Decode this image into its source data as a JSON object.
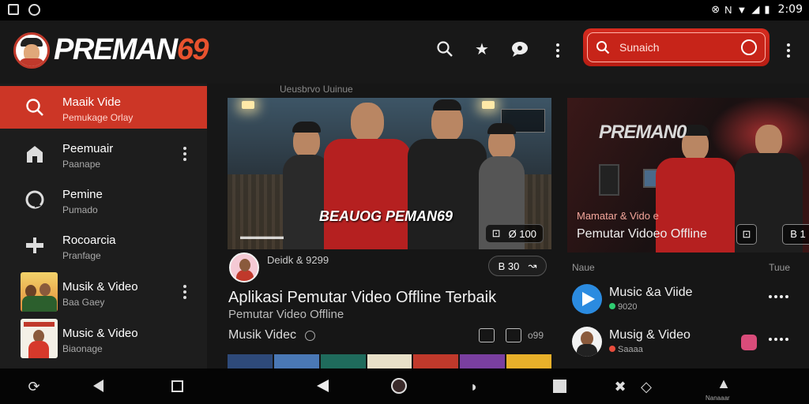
{
  "status": {
    "time": "2:09"
  },
  "header": {
    "brand_main": "PREMAN",
    "brand_num": "69",
    "search_placeholder": "Sunaich"
  },
  "icons": {
    "search": "search-icon",
    "star": "star-icon",
    "chat": "chat-icon",
    "more": "more-vert-icon",
    "mic": "mic-icon"
  },
  "sidebar": {
    "items": [
      {
        "title": "Maaik Vide",
        "sub": "Pemukage Orlay",
        "icon": "search-icon",
        "active": true
      },
      {
        "title": "Peemuair",
        "sub": "Paanape",
        "icon": "home-icon"
      },
      {
        "title": "Pemine",
        "sub": "Pumado",
        "icon": "explore-icon"
      },
      {
        "title": "Rocoarcia",
        "sub": "Pranfage",
        "icon": "library-icon"
      },
      {
        "title": "Musik & Video",
        "sub": "Baa Gaey",
        "icon": "thumbnail"
      },
      {
        "title": "Music & Video",
        "sub": "Biaonage",
        "icon": "thumbnail"
      }
    ]
  },
  "main": {
    "top_faint": "Ueusbrvo Uuinue",
    "featured": {
      "overlay_title": "BEAUOG PEMAN69",
      "badge": "Ø 100",
      "channel": "Deidk & 9299",
      "pill": "B 30",
      "title": "Aplikasi Pemutar Video Offline Terbaik",
      "subtitle": "Pemutar Video Offline",
      "category": "Musik Videc",
      "action_text": "o99"
    },
    "side_card": {
      "title": "PREMAN0",
      "line1": "Mamatar & Vido e",
      "line2": "Pemutar Vidoeo Offline",
      "btn_r": "B 1"
    },
    "list_hdr_l": "Naue",
    "list_hdr_r": "Tuue",
    "list": [
      {
        "title": "Music &a Viide",
        "sub": "9020"
      },
      {
        "title": "Musig & Video",
        "sub": "Saaaa"
      }
    ]
  },
  "navbar": {
    "label": "Nanaaar"
  }
}
